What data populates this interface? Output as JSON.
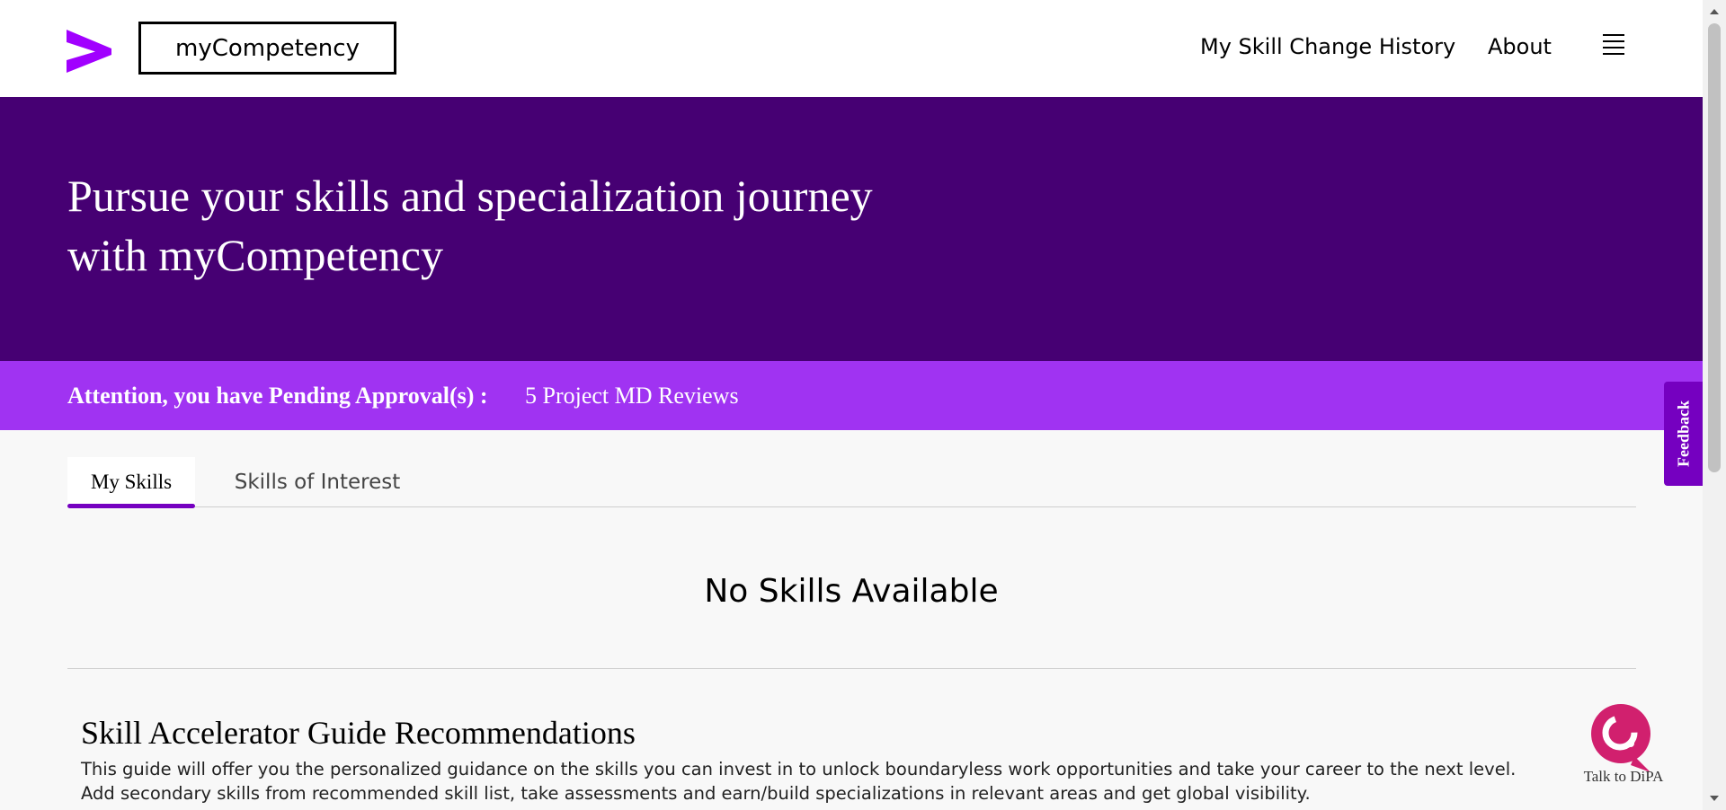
{
  "header": {
    "app_name": "myCompetency",
    "nav": {
      "skill_change_history": "My Skill Change History",
      "about": "About"
    },
    "logo_icon": "accenture-greater-than-logo",
    "menu_icon": "hamburger-menu-icon"
  },
  "hero": {
    "title_line1": "Pursue your skills and specialization journey",
    "title_line2": "with myCompetency"
  },
  "attention": {
    "label": "Attention, you have Pending Approval(s) :",
    "link": "5 Project MD Reviews"
  },
  "tabs": [
    {
      "label": "My Skills",
      "active": true
    },
    {
      "label": "Skills of Interest",
      "active": false
    }
  ],
  "content": {
    "empty_message": "No Skills Available"
  },
  "guide": {
    "title": "Skill Accelerator Guide Recommendations",
    "line1": "This guide will offer you the personalized guidance on the skills you can invest in to unlock boundaryless work opportunities and take your career to the next level.",
    "line2": "Add secondary skills from recommended skill list, take assessments and earn/build specializations in relevant areas and get global visibility."
  },
  "feedback": {
    "label": "Feedback"
  },
  "dipa": {
    "label": "Talk to DiPA"
  },
  "colors": {
    "brand_purple_dark": "#460073",
    "brand_purple_bright": "#a033f2",
    "accent_purple": "#7500c0",
    "dipa_pink": "#d1206e"
  }
}
